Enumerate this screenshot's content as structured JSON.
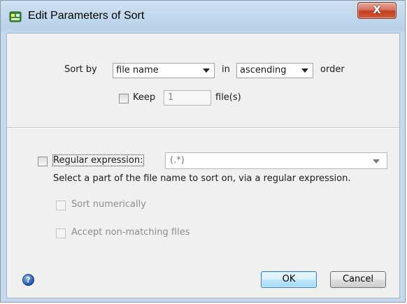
{
  "window": {
    "title": "Edit Parameters of Sort",
    "close_label": "X"
  },
  "sort": {
    "sort_by_label": "Sort by",
    "field_value": "file name",
    "in_label": "in",
    "order_value": "ascending",
    "order_label": "order",
    "keep_label": "Keep",
    "keep_value": "1",
    "files_label": "file(s)"
  },
  "regex": {
    "checkbox_label": "Regular expression:",
    "value": "(.*)",
    "hint": "Select a part of the file name to sort on, via a regular expression.",
    "sort_numerically_label": "Sort numerically",
    "accept_non_matching_label": "Accept non-matching files"
  },
  "footer": {
    "help_glyph": "?",
    "ok_label": "OK",
    "cancel_label": "Cancel"
  },
  "colors": {
    "close_button": "#c23d22",
    "title_bar": "#b9d1ea",
    "dialog_background": "#f0f0f0",
    "default_button_border": "#3c7fb1"
  },
  "icons": [
    "app-icon",
    "close-icon",
    "chevron-down-icon",
    "help-icon"
  ]
}
